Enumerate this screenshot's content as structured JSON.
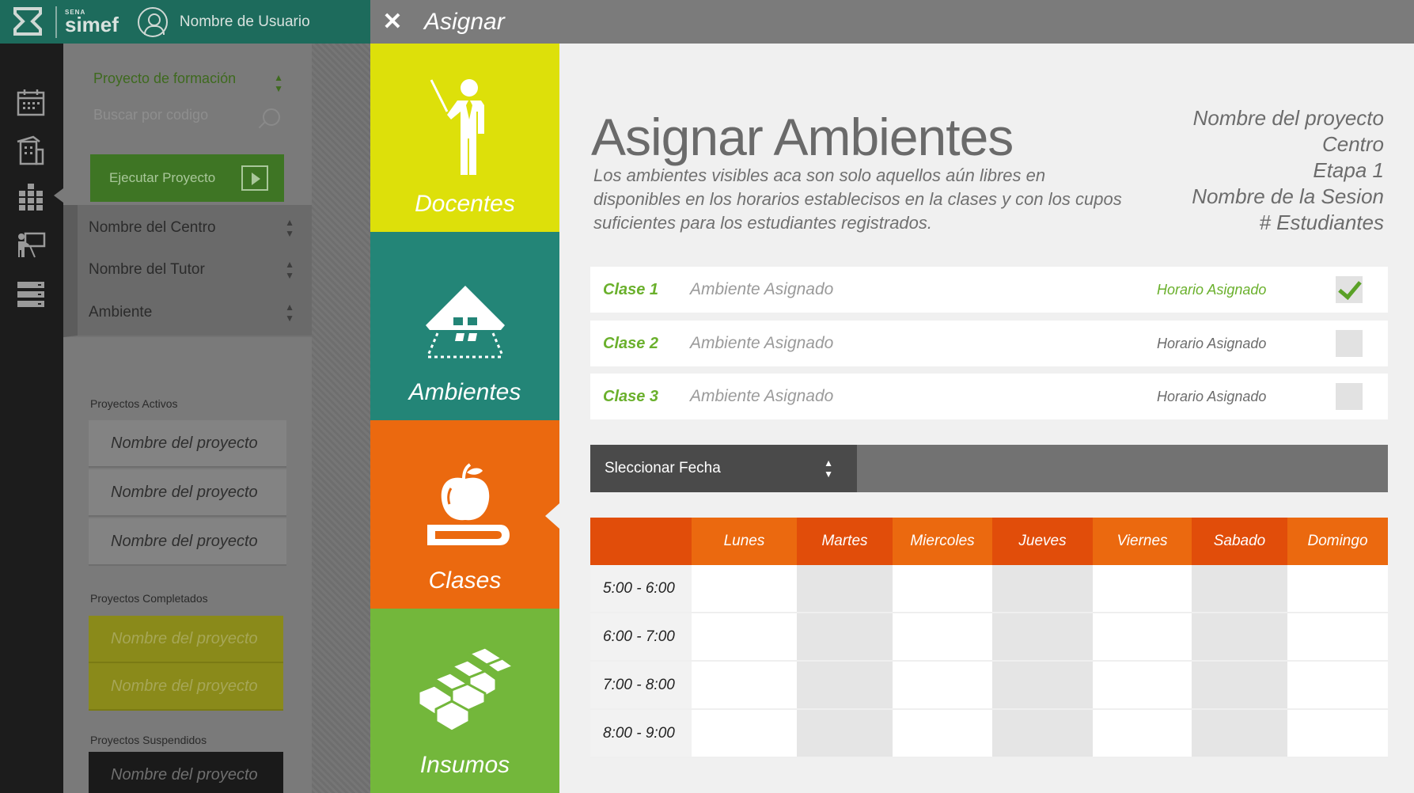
{
  "app": {
    "logo_icon": "sena-x-logo-icon",
    "brand_top": "SENA",
    "brand_name": "simef",
    "username": "Nombre de  Usuario"
  },
  "rail": {
    "icons": [
      "calendar-icon",
      "building-icon",
      "grid-icon",
      "teacher-icon",
      "database-icon"
    ]
  },
  "sidebar": {
    "project_type": "Proyecto de formación",
    "search_placeholder": "Buscar por codigo",
    "run_button": "Ejecutar Proyecto",
    "filters": [
      "Nombre del Centro",
      "Nombre del Tutor",
      "Ambiente"
    ],
    "active_title": "Proyectos Activos",
    "active_projects": [
      "Nombre del proyecto",
      "Nombre del proyecto",
      "Nombre del proyecto"
    ],
    "completed_title": "Proyectos Completados",
    "completed_projects": [
      "Nombre del proyecto",
      "Nombre del proyecto"
    ],
    "suspended_title": "Proyectos Suspendidos",
    "suspended_projects": [
      "Nombre del proyecto"
    ]
  },
  "modal": {
    "title": "Asignar",
    "tabs": [
      {
        "label": "Docentes",
        "icon": "teacher-icon",
        "color": "#dde00a"
      },
      {
        "label": "Ambientes",
        "icon": "house-icon",
        "color": "#238577"
      },
      {
        "label": "Clases",
        "icon": "apple-book-icon",
        "color": "#eb690f"
      },
      {
        "label": "Insumos",
        "icon": "bricks-icon",
        "color": "#73b73b"
      }
    ],
    "heading": "Asignar Ambientes",
    "description": "Los ambientes visibles aca son solo aquellos aún libres en disponibles en los horarios establecisos en la clases y con los cupos suficientes para los estudiantes registrados.",
    "meta": [
      "Nombre del proyecto",
      "Centro",
      "Etapa 1",
      "Nombre de la Sesion",
      "# Estudiantes"
    ],
    "clases": [
      {
        "name": "Clase 1",
        "ambiente": "Ambiente Asignado",
        "horario": "Horario Asignado",
        "checked": true
      },
      {
        "name": "Clase 2",
        "ambiente": "Ambiente Asignado",
        "horario": "Horario Asignado",
        "checked": false
      },
      {
        "name": "Clase 3",
        "ambiente": "Ambiente Asignado",
        "horario": "Horario Asignado",
        "checked": false
      }
    ],
    "date_select": "Sleccionar Fecha",
    "schedule": {
      "days": [
        "Lunes",
        "Martes",
        "Miercoles",
        "Jueves",
        "Viernes",
        "Sabado",
        "Domingo"
      ],
      "day_colors": [
        "#eb690f",
        "#e14d0a",
        "#eb690f",
        "#e14d0a",
        "#eb690f",
        "#e14d0a",
        "#eb690f"
      ],
      "times": [
        "5:00 - 6:00",
        "6:00 - 7:00",
        "7:00 - 8:00",
        "8:00 - 9:00"
      ]
    }
  }
}
